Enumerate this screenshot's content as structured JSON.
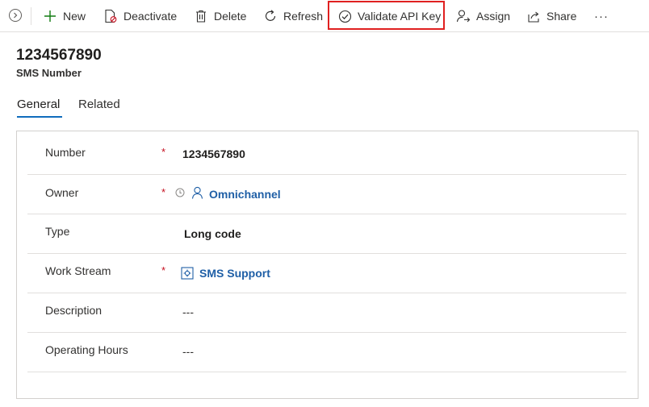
{
  "toolbar": {
    "items": [
      {
        "label": "New",
        "icon": "plus-icon"
      },
      {
        "label": "Deactivate",
        "icon": "deactivate-icon"
      },
      {
        "label": "Delete",
        "icon": "trash-icon"
      },
      {
        "label": "Refresh",
        "icon": "refresh-icon"
      },
      {
        "label": "Validate API Key",
        "icon": "check-circle-icon"
      },
      {
        "label": "Assign",
        "icon": "assign-icon"
      },
      {
        "label": "Share",
        "icon": "share-icon"
      }
    ],
    "more": "···",
    "highlight_color": "#e02020"
  },
  "record": {
    "title": "1234567890",
    "subtitle": "SMS Number"
  },
  "tabs": [
    {
      "label": "General",
      "active": true
    },
    {
      "label": "Related",
      "active": false
    }
  ],
  "form": {
    "required_marker": "*",
    "fields": [
      {
        "label": "Number",
        "required": true,
        "value": "1234567890"
      },
      {
        "label": "Owner",
        "required": true,
        "value": "Omnichannel",
        "icon": "user-icon"
      },
      {
        "label": "Type",
        "required": false,
        "value": "Long code"
      },
      {
        "label": "Work Stream",
        "required": true,
        "value": "SMS Support",
        "icon": "workstream-icon"
      },
      {
        "label": "Description",
        "required": false,
        "value": "---"
      },
      {
        "label": "Operating Hours",
        "required": false,
        "value": "---"
      }
    ]
  },
  "colors": {
    "accent": "#0f6cbd",
    "link": "#1f5fa6",
    "required": "#c50f1f"
  }
}
